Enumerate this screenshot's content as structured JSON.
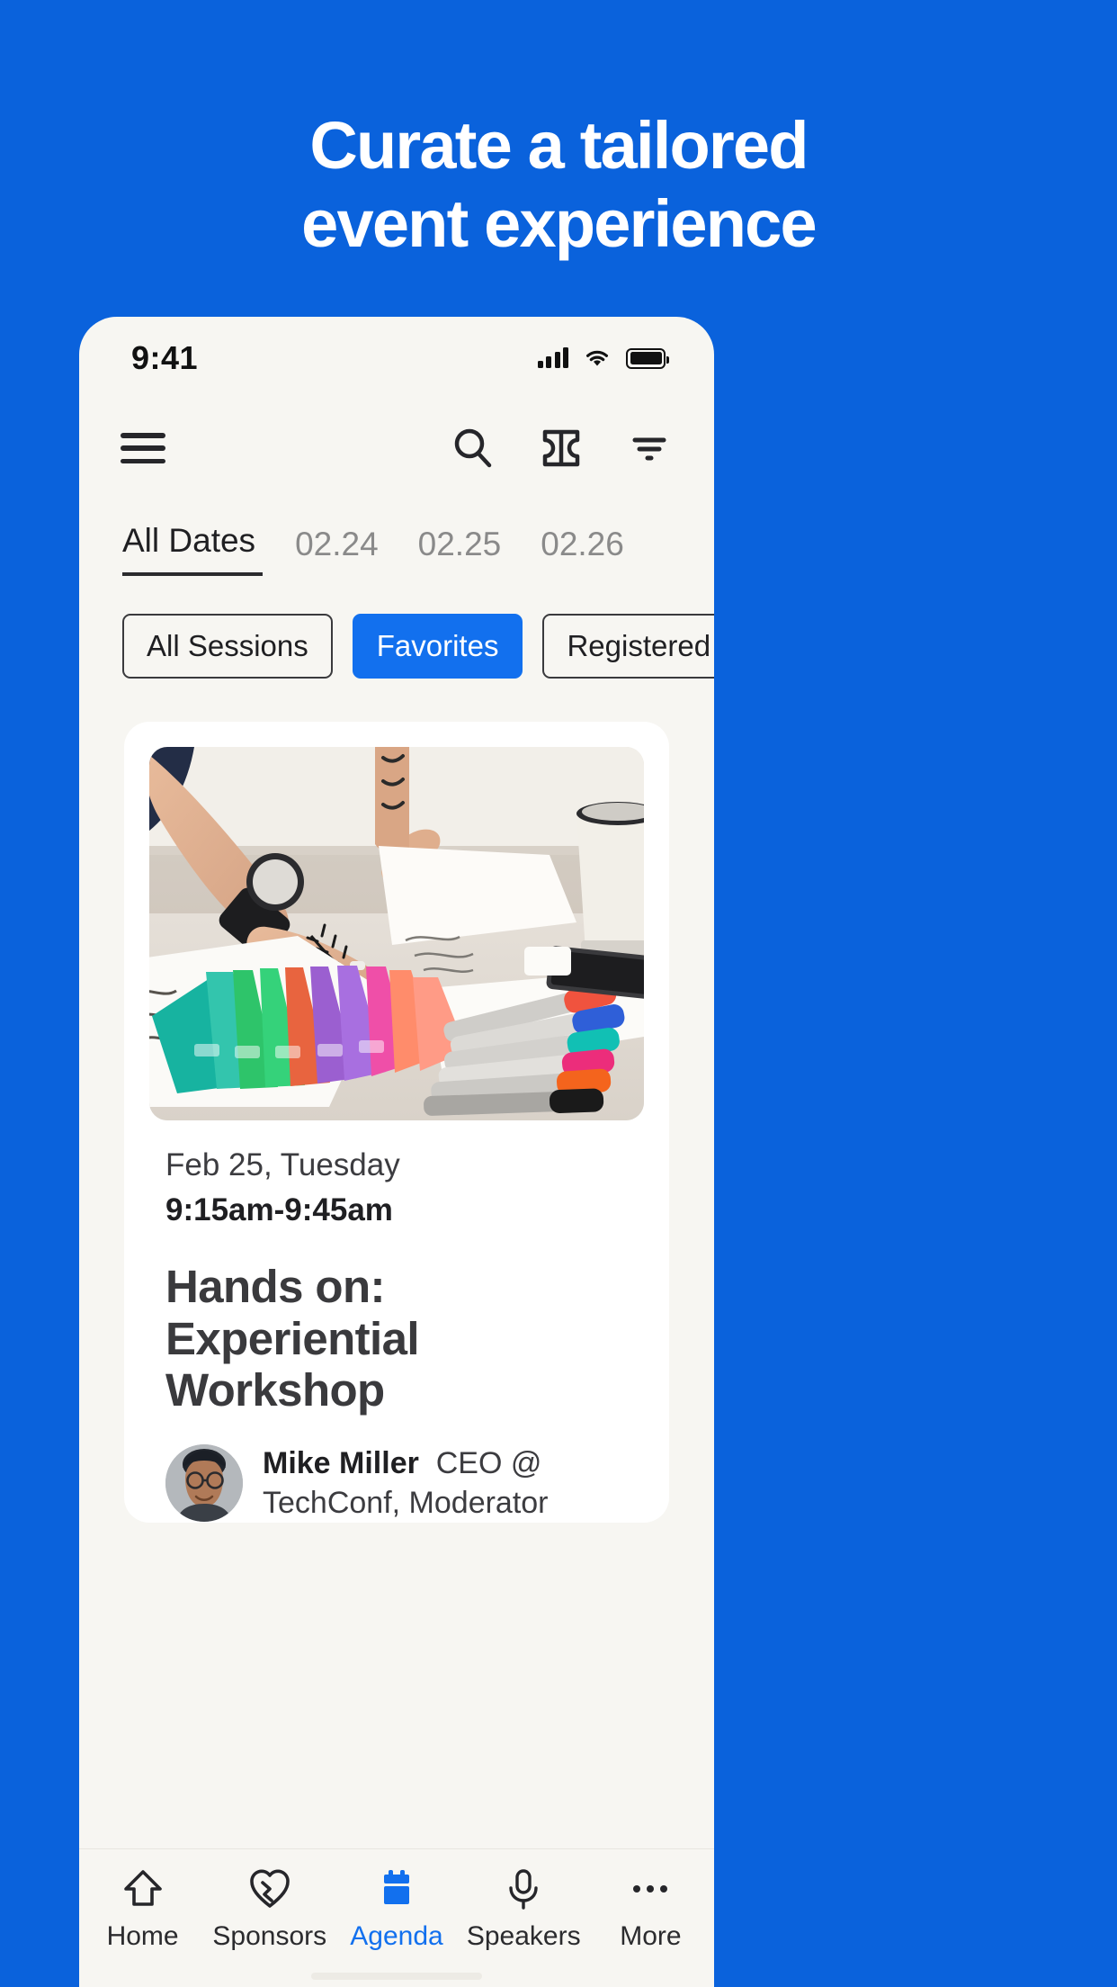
{
  "colors": {
    "background_blue": "#0A62DC",
    "accent_blue": "#1270EE",
    "phone_bg": "#F7F6F2",
    "card_bg": "#FFFFFF",
    "text_dark": "#1F1F22",
    "text_muted": "#8A8A8A"
  },
  "hero": {
    "line1": "Curate a tailored",
    "line2": "event experience"
  },
  "status_bar": {
    "time": "9:41",
    "signal_icon": "cellular-signal-icon",
    "wifi_icon": "wifi-icon",
    "battery_icon": "battery-full-icon"
  },
  "app_header": {
    "menu_icon": "hamburger-menu-icon",
    "search_icon": "search-icon",
    "ticket_icon": "ticket-icon",
    "filter_icon": "filter-icon"
  },
  "date_tabs": [
    {
      "label": "All Dates",
      "active": true
    },
    {
      "label": "02.24",
      "active": false
    },
    {
      "label": "02.25",
      "active": false
    },
    {
      "label": "02.26",
      "active": false
    }
  ],
  "filter_chips": [
    {
      "label": "All Sessions",
      "selected": false
    },
    {
      "label": "Favorites",
      "selected": true
    },
    {
      "label": "Registered",
      "selected": false
    }
  ],
  "session_card": {
    "photo_alt": "design-workshop-photo",
    "date": "Feb 25, Tuesday",
    "time": "9:15am-9:45am",
    "title": "Hands on: Experiential Workshop",
    "speaker": {
      "name": "Mike Miller",
      "title": "CEO @ TechConf,",
      "title_overflow": "Moderator"
    }
  },
  "bottom_nav": [
    {
      "label": "Home",
      "icon": "home-icon",
      "active": false
    },
    {
      "label": "Sponsors",
      "icon": "sponsors-heart-icon",
      "active": false
    },
    {
      "label": "Agenda",
      "icon": "calendar-icon",
      "active": true
    },
    {
      "label": "Speakers",
      "icon": "microphone-icon",
      "active": false
    },
    {
      "label": "More",
      "icon": "more-dots-icon",
      "active": false
    }
  ]
}
